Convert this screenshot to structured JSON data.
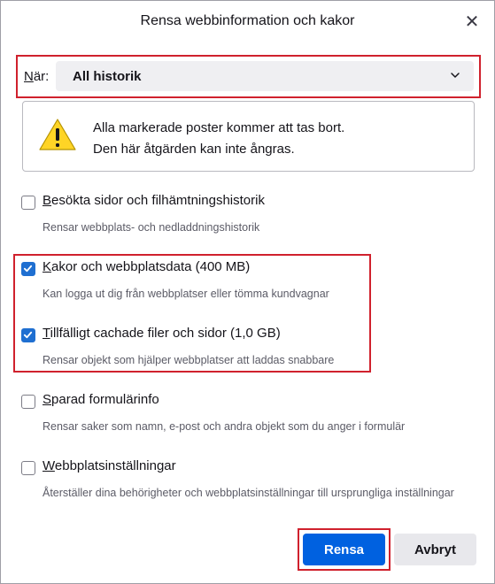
{
  "dialog": {
    "title": "Rensa webbinformation och kakor",
    "close_glyph": "✕"
  },
  "when": {
    "label_accel": "N",
    "label_rest": "är:",
    "selected": "All historik"
  },
  "warning": {
    "line1": "Alla markerade poster kommer att tas bort.",
    "line2": "Den här åtgärden kan inte ångras."
  },
  "options": [
    {
      "accel": "B",
      "label": "esökta sidor och filhämtningshistorik",
      "desc": "Rensar webbplats- och nedladdningshistorik",
      "checked": false
    },
    {
      "accel": "K",
      "label": "akor och webbplatsdata (400 MB)",
      "desc": "Kan logga ut dig från webbplatser eller tömma kundvagnar",
      "checked": true
    },
    {
      "accel": "T",
      "label": "illfälligt cachade filer och sidor (1,0 GB)",
      "desc": "Rensar objekt som hjälper webbplatser att laddas snabbare",
      "checked": true
    },
    {
      "accel": "S",
      "label": "parad formulärinfo",
      "desc": "Rensar saker som namn, e-post och andra objekt som du anger i formulär",
      "checked": false
    },
    {
      "accel": "W",
      "label": "ebbplatsinställningar",
      "desc": "Återställer dina behörigheter och webbplatsinställningar till ursprungliga inställningar",
      "checked": false
    }
  ],
  "buttons": {
    "clear": "Rensa",
    "cancel": "Avbryt"
  },
  "colors": {
    "accent": "#0061e0",
    "checkbox": "#1f6fd1",
    "highlight": "#d0212d",
    "warning": "#ffd426"
  },
  "icons": {
    "close": "close-icon",
    "dropdown": "chevron-down-icon",
    "warning": "warning-icon",
    "check": "checkmark-icon"
  }
}
